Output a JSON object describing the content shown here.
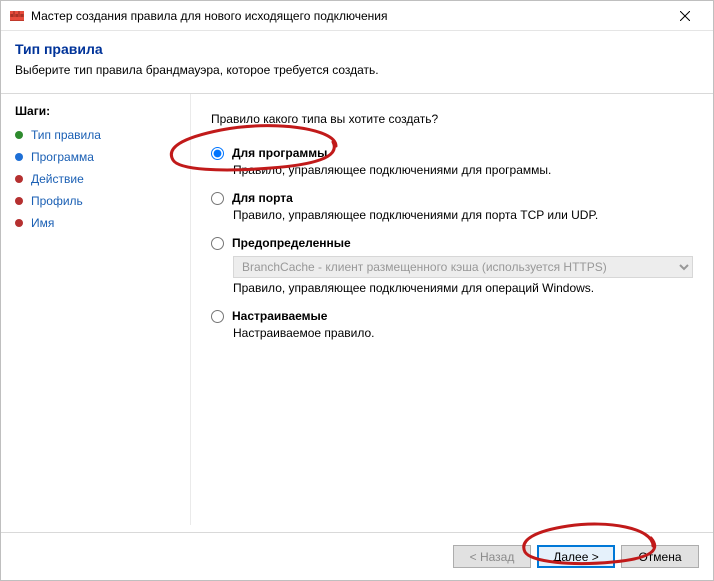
{
  "window": {
    "title": "Мастер создания правила для нового исходящего подключения"
  },
  "header": {
    "title": "Тип правила",
    "subtitle": "Выберите тип правила брандмауэра, которое требуется создать."
  },
  "sidebar": {
    "heading": "Шаги:",
    "steps": [
      {
        "label": "Тип правила",
        "bullet": "green"
      },
      {
        "label": "Программа",
        "bullet": "blue"
      },
      {
        "label": "Действие",
        "bullet": "red"
      },
      {
        "label": "Профиль",
        "bullet": "red"
      },
      {
        "label": "Имя",
        "bullet": "red"
      }
    ]
  },
  "main": {
    "question": "Правило какого типа вы хотите создать?",
    "options": [
      {
        "id": "program",
        "title": "Для программы",
        "desc": "Правило, управляющее подключениями для программы.",
        "selected": true
      },
      {
        "id": "port",
        "title": "Для порта",
        "desc": "Правило, управляющее подключениями для порта TCP или UDP.",
        "selected": false
      },
      {
        "id": "predefined",
        "title": "Предопределенные",
        "desc": "Правило, управляющее подключениями для операций Windows.",
        "selected": false,
        "dropdown": "BranchCache - клиент размещенного кэша (используется HTTPS)"
      },
      {
        "id": "custom",
        "title": "Настраиваемые",
        "desc": "Настраиваемое правило.",
        "selected": false
      }
    ]
  },
  "footer": {
    "back": "< Назад",
    "next": "Далее >",
    "cancel": "Отмена"
  }
}
